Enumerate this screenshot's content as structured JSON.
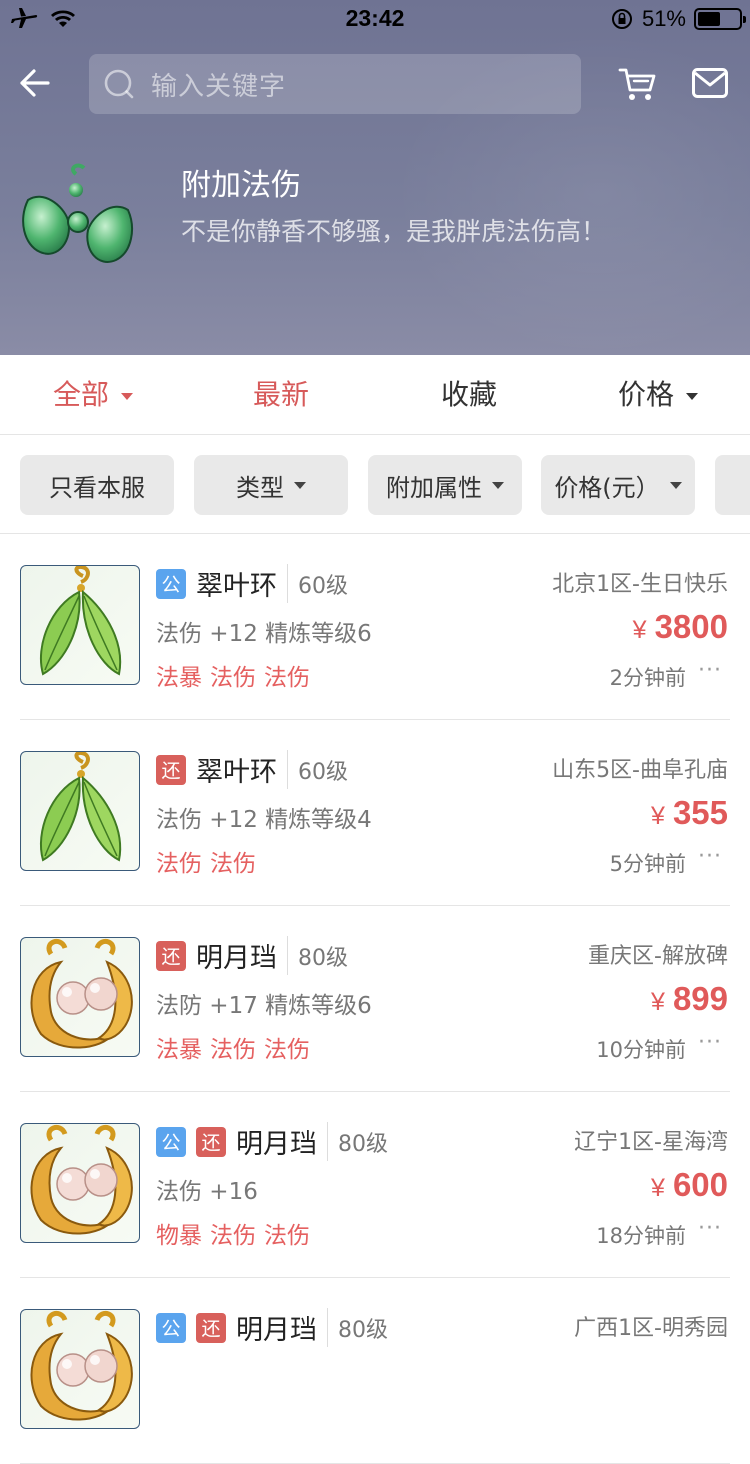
{
  "status": {
    "time": "23:42",
    "battery": "51%"
  },
  "search": {
    "placeholder": "输入关键字"
  },
  "banner": {
    "title": "附加法伤",
    "subtitle": "不是你静香不够骚，是我胖虎法伤高！"
  },
  "tabs": [
    {
      "label": "全部",
      "active": true,
      "has_caret": true
    },
    {
      "label": "最新",
      "active": true,
      "has_caret": false
    },
    {
      "label": "收藏",
      "active": false,
      "has_caret": false
    },
    {
      "label": "价格",
      "active": false,
      "has_caret": true
    }
  ],
  "filters": [
    "只看本服",
    "类型",
    "附加属性",
    "价格(元）"
  ],
  "items": [
    {
      "badges": [
        "公"
      ],
      "name": "翠叶环",
      "level": "60级",
      "server": "北京1区-生日快乐",
      "stat": "法伤 +12 精炼等级6",
      "currency": "¥",
      "price": "3800",
      "tags": [
        "法暴",
        "法伤",
        "法伤"
      ],
      "time": "2分钟前",
      "more": "···",
      "icon": "jade-leaf-earring-icon"
    },
    {
      "badges": [
        "还"
      ],
      "name": "翠叶环",
      "level": "60级",
      "server": "山东5区-曲阜孔庙",
      "stat": "法伤 +12 精炼等级4",
      "currency": "¥",
      "price": "355",
      "tags": [
        "法伤",
        "法伤"
      ],
      "time": "5分钟前",
      "more": "···",
      "icon": "jade-leaf-earring-icon"
    },
    {
      "badges": [
        "还"
      ],
      "name": "明月珰",
      "level": "80级",
      "server": "重庆区-解放碑",
      "stat": "法防 +17 精炼等级6",
      "currency": "¥",
      "price": "899",
      "tags": [
        "法暴",
        "法伤",
        "法伤"
      ],
      "time": "10分钟前",
      "more": "···",
      "icon": "pearl-moon-earring-icon"
    },
    {
      "badges": [
        "公",
        "还"
      ],
      "name": "明月珰",
      "level": "80级",
      "server": "辽宁1区-星海湾",
      "stat": "法伤 +16",
      "currency": "¥",
      "price": "600",
      "tags": [
        "物暴",
        "法伤",
        "法伤"
      ],
      "time": "18分钟前",
      "more": "···",
      "icon": "pearl-moon-earring-icon"
    },
    {
      "badges": [
        "公",
        "还"
      ],
      "name": "明月珰",
      "level": "80级",
      "server": "广西1区-明秀园",
      "stat": "",
      "currency": "",
      "price": "",
      "tags": [],
      "time": "",
      "more": "",
      "icon": "pearl-moon-earring-icon"
    }
  ],
  "colors": {
    "accent": "#d75a5a",
    "price": "#e05a5a",
    "badge_public": "#5aa4ee",
    "badge_return": "#d8605b"
  }
}
